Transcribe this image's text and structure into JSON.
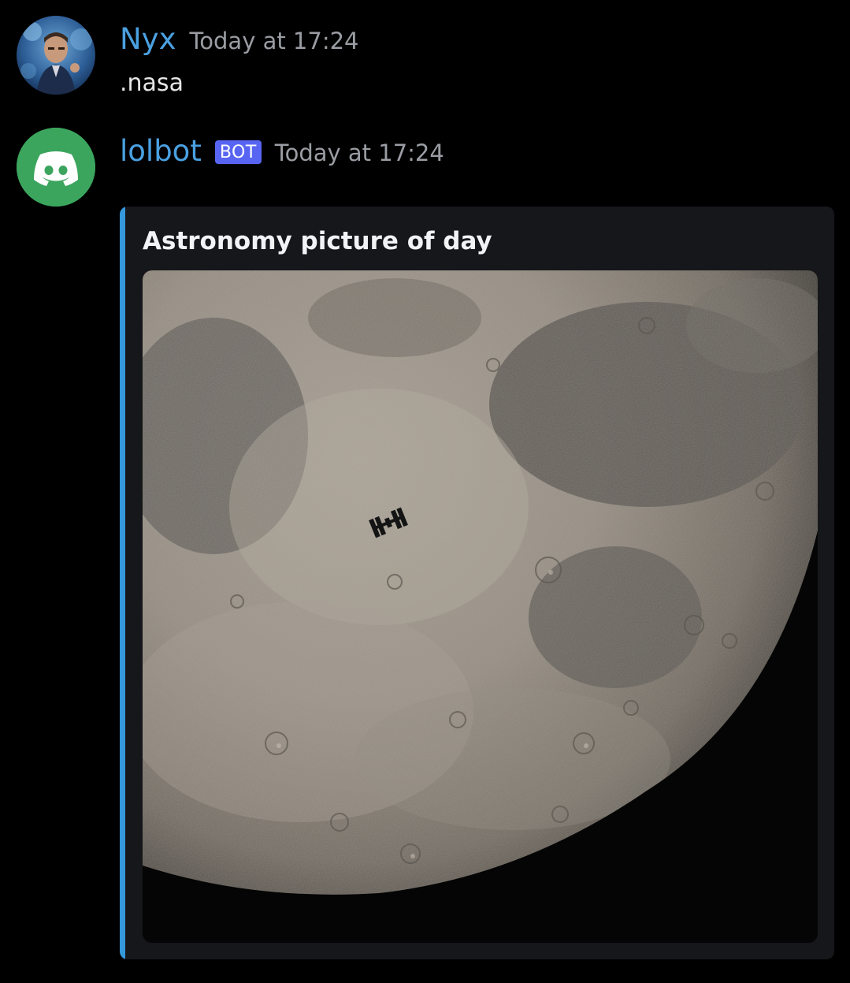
{
  "messages": [
    {
      "username": "Nyx",
      "timestamp": "Today at 17:24",
      "content": ".nasa",
      "avatar_icon": "user-avatar"
    },
    {
      "username": "lolbot",
      "bot_tag": "BOT",
      "timestamp": "Today at 17:24",
      "avatar_icon": "discord-logo-icon",
      "embed": {
        "title": "Astronomy picture of day",
        "image": "moon-with-iss-photo",
        "accent_color": "#3498db"
      }
    }
  ],
  "colors": {
    "background": "#000000",
    "username": "#4aa0e0",
    "timestamp": "#9a9da3",
    "bot_tag": "#5865f2",
    "bot_avatar": "#3ba55d",
    "embed_background": "#16171b"
  }
}
